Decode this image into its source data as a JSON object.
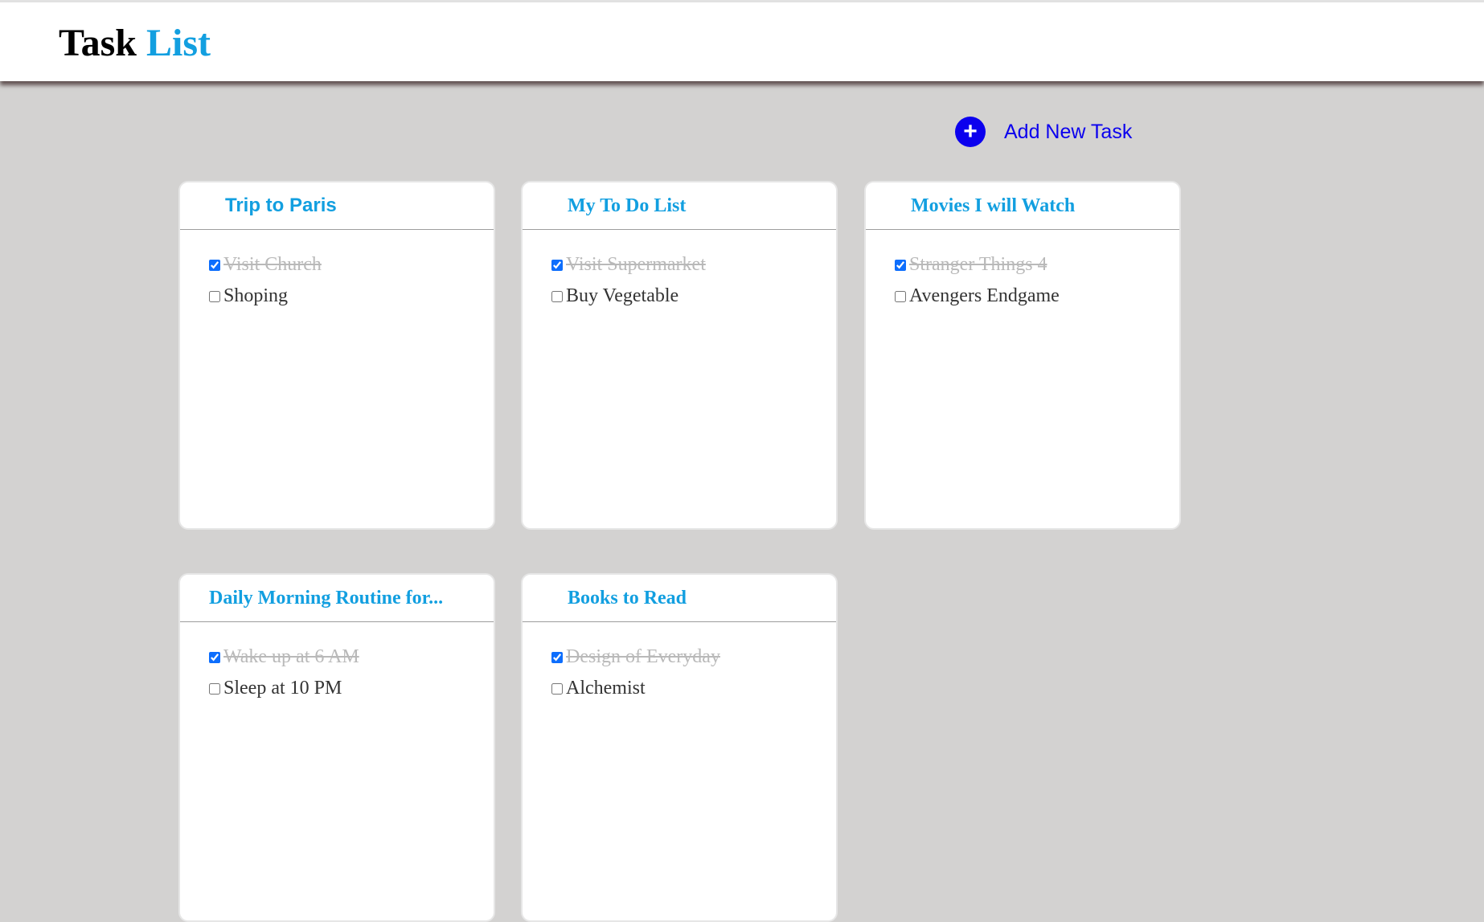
{
  "header": {
    "logo_word1": "Task",
    "logo_word2": "List"
  },
  "actions": {
    "add_icon": "+",
    "add_label": "Add New Task"
  },
  "colors": {
    "page_bg": "#d3d2d1",
    "accent": "#129fe0",
    "add_button": "#0b00ee",
    "done_text": "#b9b9b9"
  },
  "lists": [
    {
      "title": "Trip to Paris",
      "items": [
        {
          "text": "Visit Church",
          "checked": true
        },
        {
          "text": "Shoping",
          "checked": false
        }
      ]
    },
    {
      "title": "My To Do List",
      "items": [
        {
          "text": "Visit Supermarket",
          "checked": true
        },
        {
          "text": "Buy Vegetable",
          "checked": false
        }
      ]
    },
    {
      "title": "Movies I will Watch",
      "items": [
        {
          "text": "Stranger Things 4",
          "checked": true
        },
        {
          "text": "Avengers Endgame",
          "checked": false
        }
      ]
    },
    {
      "title": "Daily Morning Routine for...",
      "items": [
        {
          "text": "Wake up at 6 AM",
          "checked": true
        },
        {
          "text": "Sleep at 10 PM",
          "checked": false
        }
      ]
    },
    {
      "title": "Books to Read",
      "items": [
        {
          "text": "Design of Everyday",
          "checked": true
        },
        {
          "text": "Alchemist",
          "checked": false
        }
      ]
    }
  ]
}
